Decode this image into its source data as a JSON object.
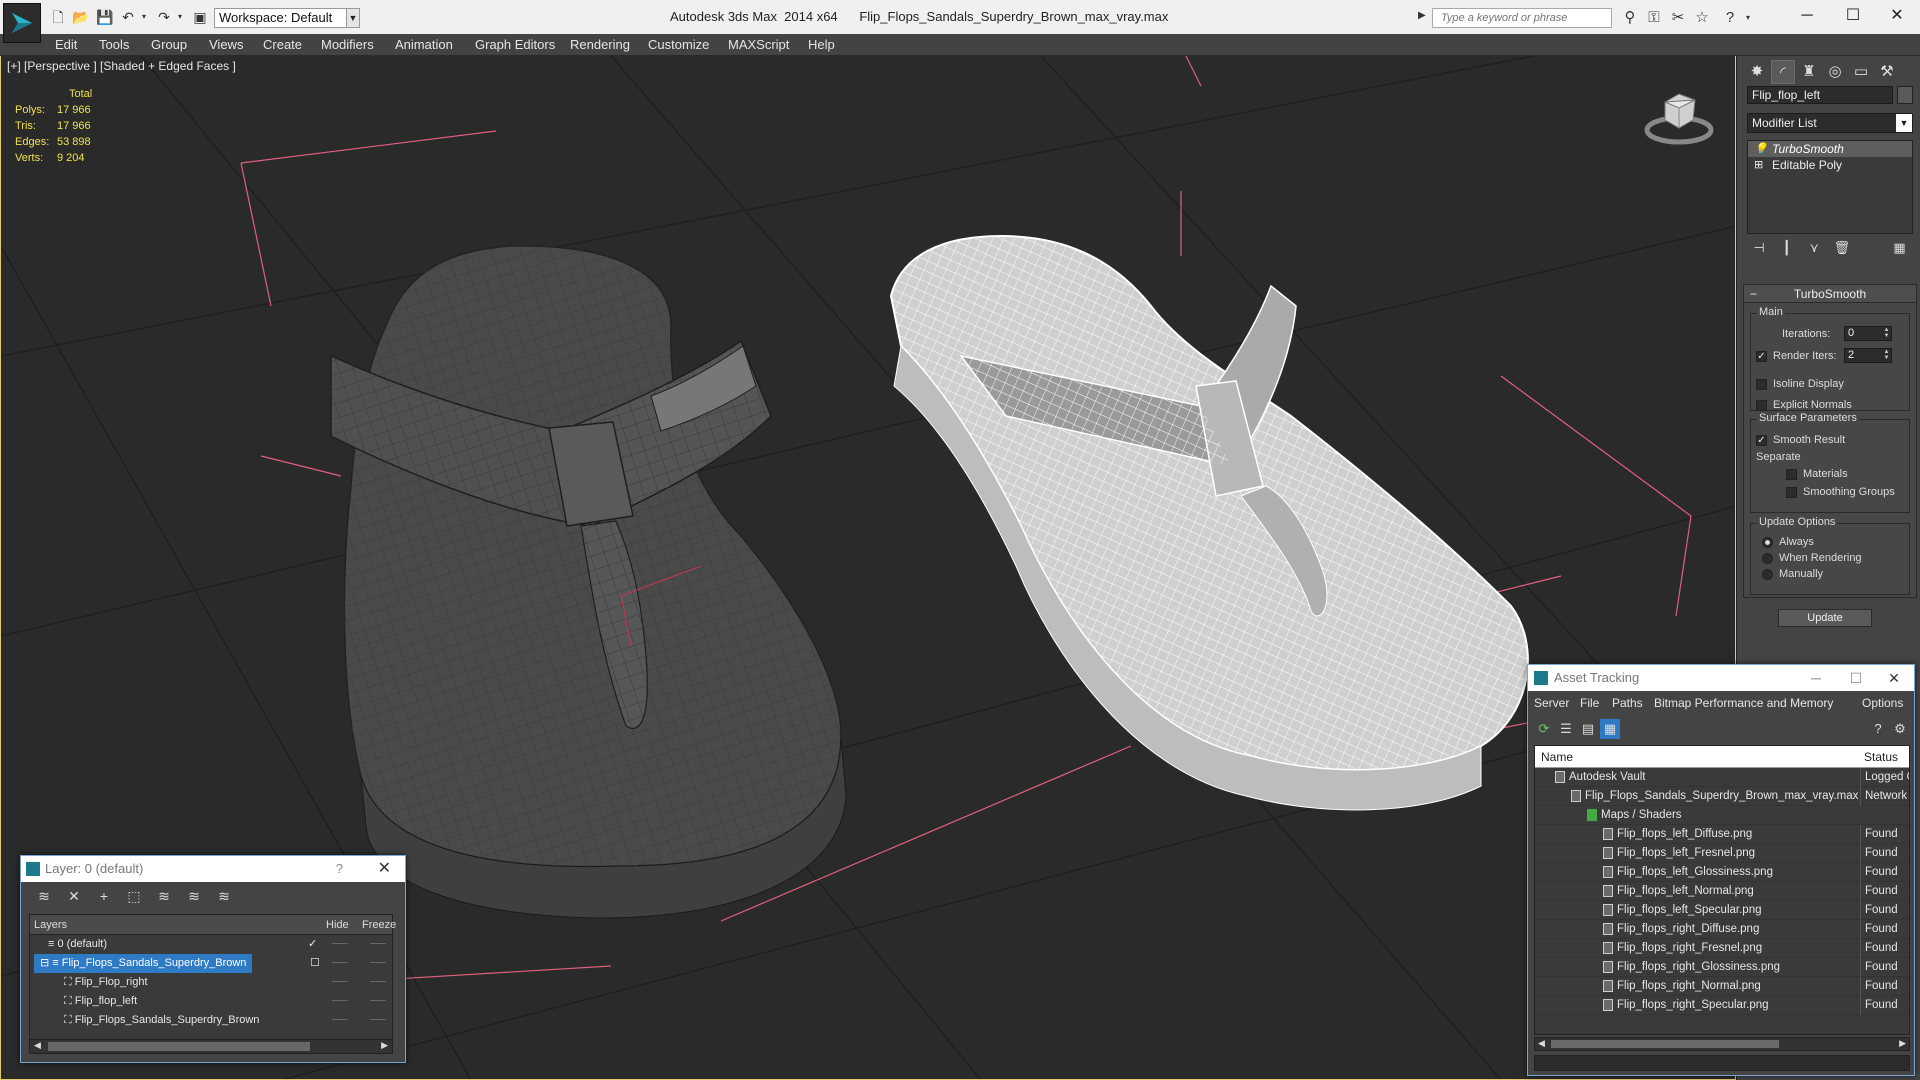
{
  "titlebar": {
    "workspace": "Workspace: Default",
    "app_name": "Autodesk 3ds Max  2014 x64",
    "file_name": "Flip_Flops_Sandals_Superdry_Brown_max_vray.max",
    "search_placeholder": "Type a keyword or phrase"
  },
  "menu": [
    "Edit",
    "Tools",
    "Group",
    "Views",
    "Create",
    "Modifiers",
    "Animation",
    "Graph Editors",
    "Rendering",
    "Customize",
    "MAXScript",
    "Help"
  ],
  "viewport": {
    "label": "[+] [Perspective ] [Shaded + Edged Faces ]",
    "stats": {
      "header": "Total",
      "rows": [
        {
          "label": "Polys:",
          "value": "17 966"
        },
        {
          "label": "Tris:",
          "value": "17 966"
        },
        {
          "label": "Edges:",
          "value": "53 898"
        },
        {
          "label": "Verts:",
          "value": "9 204"
        }
      ]
    }
  },
  "command_panel": {
    "object_name": "Flip_flop_left",
    "modifier_list": "Modifier List",
    "stack": [
      "TurboSmooth",
      "Editable Poly"
    ],
    "rollout_title": "TurboSmooth",
    "main_label": "Main",
    "iterations_label": "Iterations:",
    "iterations_value": "0",
    "render_iters_label": "Render Iters:",
    "render_iters_value": "2",
    "isoline_display": "Isoline Display",
    "explicit_normals": "Explicit Normals",
    "surface_params": "Surface Parameters",
    "smooth_result": "Smooth Result",
    "separate": "Separate",
    "materials": "Materials",
    "smoothing_groups": "Smoothing Groups",
    "update_options": "Update Options",
    "always": "Always",
    "when_rendering": "When Rendering",
    "manually": "Manually",
    "update_button": "Update"
  },
  "layer_dialog": {
    "title": "Layer: 0 (default)",
    "col_layers": "Layers",
    "col_hide": "Hide",
    "col_freeze": "Freeze",
    "rows": [
      {
        "name": "0 (default)"
      },
      {
        "name": "Flip_Flops_Sandals_Superdry_Brown"
      },
      {
        "name": "Flip_Flop_right"
      },
      {
        "name": "Flip_flop_left"
      },
      {
        "name": "Flip_Flops_Sandals_Superdry_Brown"
      }
    ]
  },
  "asset_dialog": {
    "title": "Asset Tracking",
    "menu": [
      "Server",
      "File",
      "Paths",
      "Bitmap Performance and Memory",
      "Options"
    ],
    "col_name": "Name",
    "col_status": "Status",
    "rows": [
      {
        "name": "Autodesk Vault",
        "status": "Logged O"
      },
      {
        "name": "Flip_Flops_Sandals_Superdry_Brown_max_vray.max",
        "status": "Network"
      },
      {
        "name": "Maps / Shaders",
        "status": ""
      },
      {
        "name": "Flip_flops_left_Diffuse.png",
        "status": "Found"
      },
      {
        "name": "Flip_flops_left_Fresnel.png",
        "status": "Found"
      },
      {
        "name": "Flip_flops_left_Glossiness.png",
        "status": "Found"
      },
      {
        "name": "Flip_flops_left_Normal.png",
        "status": "Found"
      },
      {
        "name": "Flip_flops_left_Specular.png",
        "status": "Found"
      },
      {
        "name": "Flip_flops_right_Diffuse.png",
        "status": "Found"
      },
      {
        "name": "Flip_flops_right_Fresnel.png",
        "status": "Found"
      },
      {
        "name": "Flip_flops_right_Glossiness.png",
        "status": "Found"
      },
      {
        "name": "Flip_flops_right_Normal.png",
        "status": "Found"
      },
      {
        "name": "Flip_flops_right_Specular.png",
        "status": "Found"
      }
    ]
  },
  "colors": {
    "selection": "#2f7ac5",
    "stats": "#f0e24a",
    "viewport_border": "#e2c96a",
    "bounding_box": "#e0607e"
  }
}
